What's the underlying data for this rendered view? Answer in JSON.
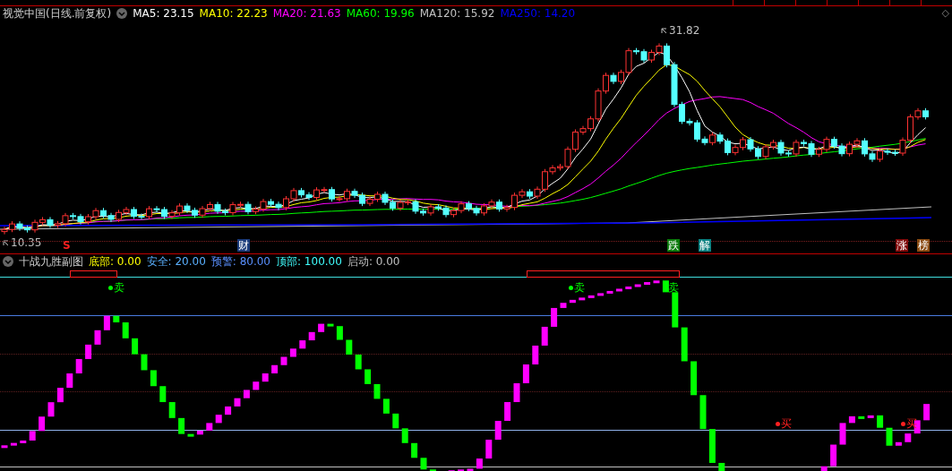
{
  "security": {
    "name": "视觉中国(日线.前复权)"
  },
  "ma": [
    {
      "label": "MA5: 23.15",
      "color": "#ffffff"
    },
    {
      "label": "MA10: 22.23",
      "color": "#ffff00"
    },
    {
      "label": "MA20: 21.63",
      "color": "#ff00ff"
    },
    {
      "label": "MA60: 19.96",
      "color": "#00ff00"
    },
    {
      "label": "MA120: 15.92",
      "color": "#c0c0c0"
    },
    {
      "label": "MA250: 14.20",
      "color": "#0000ff"
    }
  ],
  "corner_symbol": "◇",
  "main_chart": {
    "high_label": "31.82",
    "low_label": "10.35"
  },
  "events": [
    {
      "text": "S",
      "kind": "text",
      "color": "#ff2020"
    },
    {
      "text": "财",
      "kind": "badge",
      "color": "#1a3a7a"
    },
    {
      "text": "跌",
      "kind": "badge",
      "color": "#0a7a0a"
    },
    {
      "text": "解",
      "kind": "badge",
      "color": "#0a8080"
    },
    {
      "text": "涨",
      "kind": "badge",
      "color": "#800a0a"
    },
    {
      "text": "榜",
      "kind": "badge",
      "color": "#8a4a10"
    }
  ],
  "sub_panel": {
    "title": "十战九胜副图",
    "readings": [
      {
        "label": "底部: 0.00",
        "color": "#ffff00"
      },
      {
        "label": "安全: 20.00",
        "color": "#5ab0ff"
      },
      {
        "label": "预警: 80.00",
        "color": "#5a90ff"
      },
      {
        "label": "顶部: 100.00",
        "color": "#40ffff"
      },
      {
        "label": "启动: 0.00",
        "color": "#c0c0c0"
      }
    ]
  },
  "signals": [
    {
      "text": "卖",
      "kind": "sell",
      "dot": true
    },
    {
      "text": "卖",
      "kind": "sell",
      "dot": true
    },
    {
      "text": "卖",
      "kind": "sell",
      "dot": false
    },
    {
      "text": "买",
      "kind": "buy",
      "dot": true
    },
    {
      "text": "买",
      "kind": "buy",
      "dot": true
    }
  ]
}
